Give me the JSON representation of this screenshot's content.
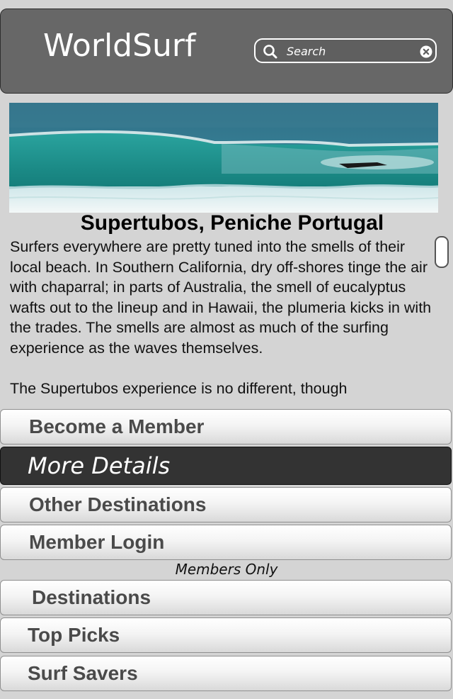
{
  "header": {
    "app_title": "WorldSurf",
    "search_placeholder": "Search"
  },
  "article": {
    "title": "Supertubos, Peniche Portugal",
    "paragraphs": [
      "Surfers everywhere are pretty tuned into the smells of their local beach. In Southern California, dry off-shores tinge the air with chaparral; in parts of Australia, the smell of eucalyptus wafts out to the lineup and in Hawaii, the plumeria kicks in with the trades. The smells are almost as much of the surfing experience as the waves themselves.",
      "The Supertubos experience is no different, though"
    ]
  },
  "menu": {
    "become_member": "Become a Member",
    "more_details": "More Details",
    "other_destinations": "Other Destinations",
    "member_login": "Member Login",
    "members_only_label": "Members Only",
    "destinations": "Destinations",
    "top_picks": "Top Picks",
    "surf_savers": "Surf Savers"
  },
  "colors": {
    "header_bg": "#676767",
    "active_button_bg": "#333333",
    "page_bg": "#d4d4d4"
  },
  "icons": {
    "search": "magnifier-icon",
    "clear": "clear-circle-icon"
  }
}
